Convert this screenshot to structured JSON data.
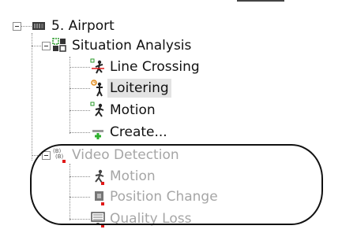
{
  "tree": {
    "root": {
      "label": "5. Airport",
      "icon": "server-icon"
    },
    "situation_analysis": {
      "label": "Situation Analysis",
      "icon": "analysis-group-icon",
      "children": [
        {
          "label": "Line Crossing",
          "icon": "line-crossing-icon"
        },
        {
          "label": "Loitering",
          "icon": "loitering-icon",
          "selected": true
        },
        {
          "label": "Motion",
          "icon": "running-man-icon"
        },
        {
          "label": "Create...",
          "icon": "add-icon"
        }
      ]
    },
    "video_detection": {
      "label": "Video Detection",
      "icon": "detection-group-icon",
      "disabled": true,
      "children": [
        {
          "label": "Motion",
          "icon": "running-man-icon"
        },
        {
          "label": "Position Change",
          "icon": "position-change-icon"
        },
        {
          "label": "Quality Loss",
          "icon": "quality-loss-icon"
        }
      ]
    }
  },
  "colors": {
    "selection": "#e3e3e3",
    "disabled_text": "#a6a6a6",
    "add_green": "#2db02d",
    "alert_red": "#e01818"
  }
}
